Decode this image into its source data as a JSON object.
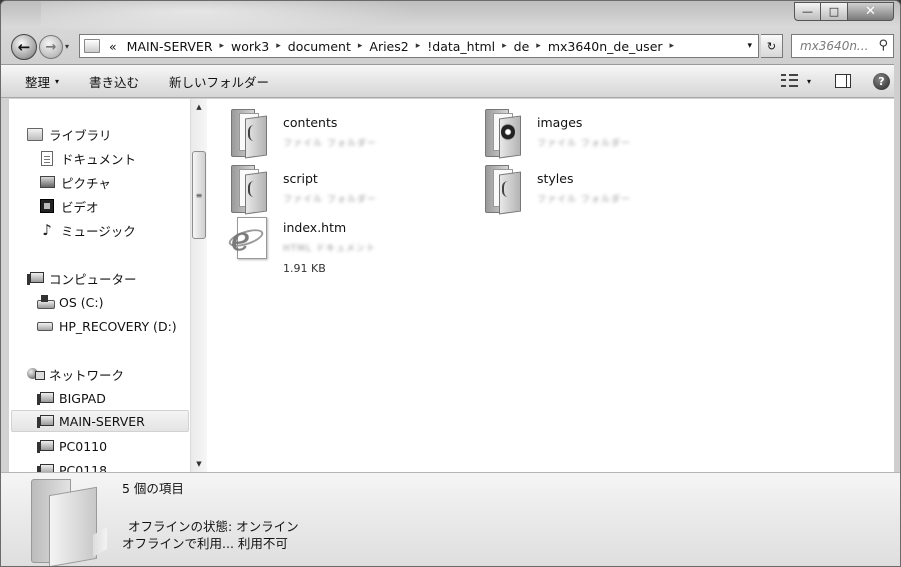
{
  "window": {
    "buttons": {
      "minimize": "—",
      "maximize": "□",
      "close": "✕"
    }
  },
  "nav": {
    "back_icon": "back-arrow-icon",
    "forward_icon": "forward-arrow-icon",
    "back_glyph": "←",
    "forward_glyph": "→"
  },
  "address": {
    "overflow": "«",
    "crumbs": [
      "MAIN-SERVER",
      "work3",
      "document",
      "Aries2",
      "!data_html",
      "de",
      "mx3640n_de_user"
    ],
    "separator": "▸",
    "dropdown": "▾",
    "refresh": "↻"
  },
  "search": {
    "placeholder": "mx3640n...",
    "icon": "⚲"
  },
  "toolbar": {
    "organize": "整理",
    "burn": "書き込む",
    "new_folder": "新しいフォルダー",
    "dropdown_arrow": "▾",
    "help": "?"
  },
  "sidebar": {
    "libraries": "ライブラリ",
    "documents": "ドキュメント",
    "pictures": "ピクチャ",
    "videos": "ビデオ",
    "music": "ミュージック",
    "computer": "コンピューター",
    "os_drive": "OS (C:)",
    "recovery_drive": "HP_RECOVERY (D:)",
    "network": "ネットワーク",
    "bigpad": "BIGPAD",
    "main_server": "MAIN-SERVER",
    "pc0110": "PC0110",
    "pc0118": "PC0118",
    "scroll_up": "▲",
    "scroll_down": "▼",
    "scroll_grip": "≡"
  },
  "files": {
    "contents": {
      "name": "contents",
      "type": "ファイル フォルダー"
    },
    "images": {
      "name": "images",
      "type": "ファイル フォルダー"
    },
    "script": {
      "name": "script",
      "type": "ファイル フォルダー"
    },
    "styles": {
      "name": "styles",
      "type": "ファイル フォルダー"
    },
    "index": {
      "name": "index.htm",
      "type": "HTML ドキュメント",
      "size": "1.91 KB",
      "glyph": "e"
    }
  },
  "details": {
    "count": "5 個の項目",
    "offline_status": "オフラインの状態: オンライン",
    "offline_availability": "オフラインで利用... 利用不可"
  }
}
